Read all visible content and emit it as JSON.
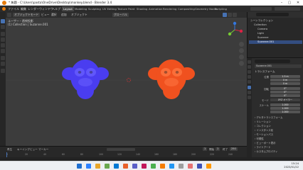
{
  "window": {
    "title": "* 無題 - C:\\Users\\pasta\\OneDrive\\Desktop\\monkey.blend - Blender 3.4",
    "controls": [
      "–",
      "▢",
      "✕"
    ]
  },
  "menu": {
    "items": [
      "ファイル",
      "編集",
      "レンダー",
      "ウィンドウ",
      "ヘルプ"
    ],
    "workspaces": [
      "Layout",
      "Modeling",
      "Sculpting",
      "UV Editing",
      "Texture Paint",
      "Shading",
      "Animation",
      "Rendering",
      "Compositing",
      "Geometry Nodes",
      "Scripting"
    ],
    "active_workspace": "Layout"
  },
  "viewport_header": {
    "mode": "オブジェクトモード",
    "menus": [
      "ビュー",
      "選択",
      "追加",
      "オブジェクト"
    ],
    "transform": "グローバル",
    "info_line1": "ユーザー・透視投影",
    "info_line2": "(1) Collection | Suzanne.001"
  },
  "scene": {
    "monkeys": [
      {
        "name": "Suzanne",
        "color": "#4a3df0",
        "highlight": "#6b63ff"
      },
      {
        "name": "Suzanne.001",
        "color": "#f0511f",
        "highlight": "#ff7a45"
      }
    ]
  },
  "timeline": {
    "menus": [
      "再生",
      "キーイング",
      "ビュー",
      "マーカー"
    ],
    "current_frame": "1",
    "start_label": "開始",
    "start": "1",
    "end_label": "終了",
    "end": "250",
    "ruler": [
      "0",
      "20",
      "40",
      "60",
      "80",
      "100",
      "120",
      "140",
      "160",
      "180",
      "200",
      "220",
      "240"
    ]
  },
  "outliner": {
    "rows": [
      {
        "label": "シーンコレクション",
        "indent": 0,
        "selected": false
      },
      {
        "label": "Collection",
        "indent": 1,
        "selected": false
      },
      {
        "label": "Camera",
        "indent": 2,
        "selected": false
      },
      {
        "label": "Light",
        "indent": 2,
        "selected": false
      },
      {
        "label": "Suzanne",
        "indent": 2,
        "selected": false
      },
      {
        "label": "Suzanne.001",
        "indent": 2,
        "selected": true
      }
    ]
  },
  "properties": {
    "object_name": "Suzanne.001",
    "section_transform": "トランスフォーム",
    "location": {
      "label": "位置",
      "x": "1.5 m",
      "y": "0 m",
      "z": "0 m"
    },
    "rotation": {
      "label": "回転",
      "x": "0°",
      "y": "0°",
      "z": "0°"
    },
    "mode": {
      "label": "モード",
      "value": "XYZ オイラー"
    },
    "scale": {
      "label": "スケール",
      "x": "1.000",
      "y": "1.000",
      "z": "1.000"
    },
    "sections": [
      "デルタトランスフォーム",
      "リレーション",
      "コレクション",
      "インスタンス化",
      "モーションパス",
      "可視性",
      "ビューポート表示",
      "ライトアート",
      "カスタムプロパティ"
    ]
  },
  "taskbar": {
    "time": "15:24",
    "date": "2023/01/22",
    "icon_colors": [
      "#1f6fd1",
      "#2f82ff",
      "#e8a62b",
      "#6aa84f",
      "#0078d4",
      "#e8612c",
      "#5b5fc7",
      "#c2185b",
      "#4caf50",
      "#f57c00",
      "#2196f3",
      "#9e9e9e",
      "#e57373",
      "#3f51b5",
      "#ff9800"
    ]
  }
}
